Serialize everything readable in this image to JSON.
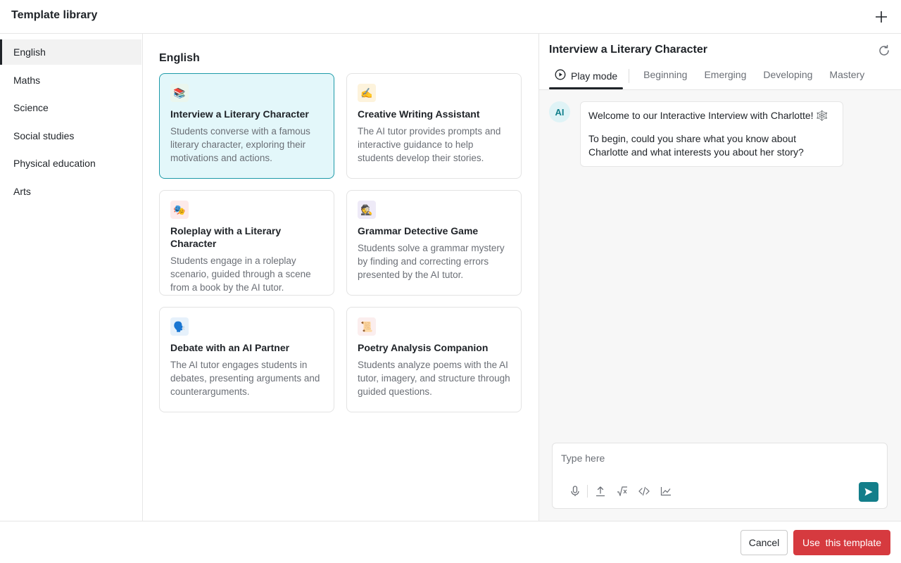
{
  "header": {
    "title": "Template library",
    "add_icon": "plus-icon"
  },
  "sidebar": {
    "items": [
      {
        "label": "English",
        "active": true
      },
      {
        "label": "Maths",
        "active": false
      },
      {
        "label": "Science",
        "active": false
      },
      {
        "label": "Social studies",
        "active": false
      },
      {
        "label": "Physical education",
        "active": false
      },
      {
        "label": "Arts",
        "active": false
      }
    ]
  },
  "main": {
    "section_title": "English",
    "cards": [
      {
        "icon": "📚",
        "title": "Interview a Literary Character",
        "description": "Students converse with a famous literary character, exploring their motivations and actions.",
        "selected": true
      },
      {
        "icon": "✍️",
        "title": "Creative Writing Assistant",
        "description": "The AI tutor provides prompts and interactive guidance to help students develop their stories.",
        "selected": false
      },
      {
        "icon": "🎭",
        "title": "Roleplay with a Literary Character",
        "description": "Students engage in a roleplay scenario, guided through a scene from a book by the AI tutor.",
        "selected": false
      },
      {
        "icon": "🕵️",
        "title": "Grammar Detective Game",
        "description": "Students solve a grammar mystery by finding and correcting errors presented by the AI tutor.",
        "selected": false
      },
      {
        "icon": "🗣️",
        "title": "Debate with an AI Partner",
        "description": "The AI tutor engages students in debates, presenting arguments and counterarguments.",
        "selected": false
      },
      {
        "icon": "📜",
        "title": "Poetry Analysis Companion",
        "description": "Students analyze poems with the AI tutor, imagery, and structure through guided questions.",
        "selected": false
      }
    ]
  },
  "preview": {
    "title": "Interview a Literary Character",
    "tabs": [
      "Play mode",
      "Beginning",
      "Emerging",
      "Developing",
      "Mastery"
    ],
    "active_tab": "Play mode",
    "avatar_label": "AI",
    "message_line1": "Welcome to our Interactive Interview with Charlotte! 🕸️",
    "message_line2": "To begin, could you share what you know about Charlotte and what interests you about her story?",
    "input_placeholder": "Type here"
  },
  "footer": {
    "cancel_label": "Cancel",
    "use_label": "Use  this template"
  },
  "colors": {
    "accent_teal": "#137e8a",
    "selected_card_bg": "#e3f7fa",
    "primary_red": "#d63a3f"
  }
}
